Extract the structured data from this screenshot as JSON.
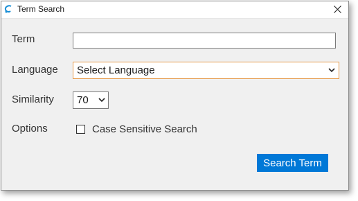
{
  "window": {
    "title": "Term Search",
    "icon": "app-logo-icon",
    "close_icon": "close-icon"
  },
  "form": {
    "term_label": "Term",
    "term_value": "",
    "language_label": "Language",
    "language_selected": "Select Language",
    "similarity_label": "Similarity",
    "similarity_selected": "70",
    "options_label": "Options",
    "case_sensitive_label": "Case Sensitive Search",
    "case_sensitive_checked": false,
    "search_button_label": "Search Term"
  },
  "colors": {
    "accent": "#0078d7",
    "focus_border": "#e69a4a",
    "panel_bg": "#f0f0f0"
  }
}
